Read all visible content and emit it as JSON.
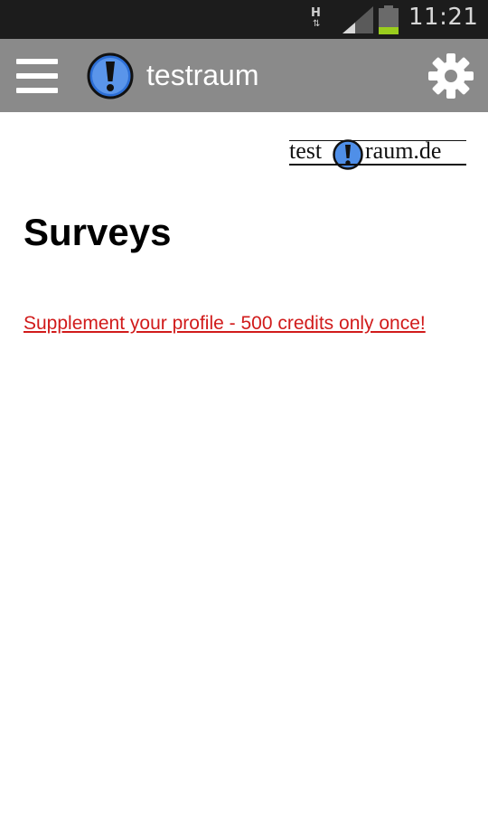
{
  "status_bar": {
    "network_type": "H",
    "network_arrows": "⇅",
    "signal_icon": "signal-icon",
    "battery_icon": "battery-icon",
    "time": "11:21"
  },
  "action_bar": {
    "menu_icon": "hamburger-menu-icon",
    "logo_icon": "exclamation-logo-icon",
    "title": "testraum",
    "settings_icon": "gear-icon",
    "background_color": "#8a8a8a"
  },
  "brand": {
    "text_before": "test",
    "text_after": "raum.de",
    "mark_icon": "exclamation-logo-icon"
  },
  "content": {
    "title": "Surveys",
    "link_text": "Supplement your profile - 500 credits only once!",
    "link_color": "#d11b1b"
  }
}
